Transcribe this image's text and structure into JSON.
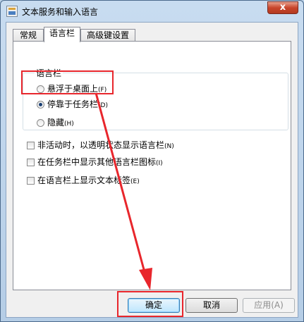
{
  "window": {
    "title": "文本服务和输入语言",
    "close_glyph": "x"
  },
  "tabs": [
    {
      "label": "常规"
    },
    {
      "label": "语言栏"
    },
    {
      "label": "高级键设置"
    }
  ],
  "language_bar": {
    "group_label": "语言栏",
    "options": [
      {
        "label": "悬浮于桌面上",
        "shortcut": "(F)"
      },
      {
        "label": "停靠于任务栏",
        "shortcut": "(D)"
      },
      {
        "label": "隐藏",
        "shortcut": "(H)"
      }
    ],
    "selected": "停靠于任务栏"
  },
  "checkboxes": [
    {
      "label": "非活动时，以透明状态显示语言栏",
      "shortcut": "(N)",
      "checked": false
    },
    {
      "label": "在任务栏中显示其他语言栏图标",
      "shortcut": "(I)",
      "checked": false
    },
    {
      "label": "在语言栏上显示文本标签",
      "shortcut": "(E)",
      "checked": false
    }
  ],
  "buttons": {
    "ok": "确定",
    "cancel": "取消",
    "apply": "应用(A)"
  },
  "annotation_color": "#e8262c"
}
